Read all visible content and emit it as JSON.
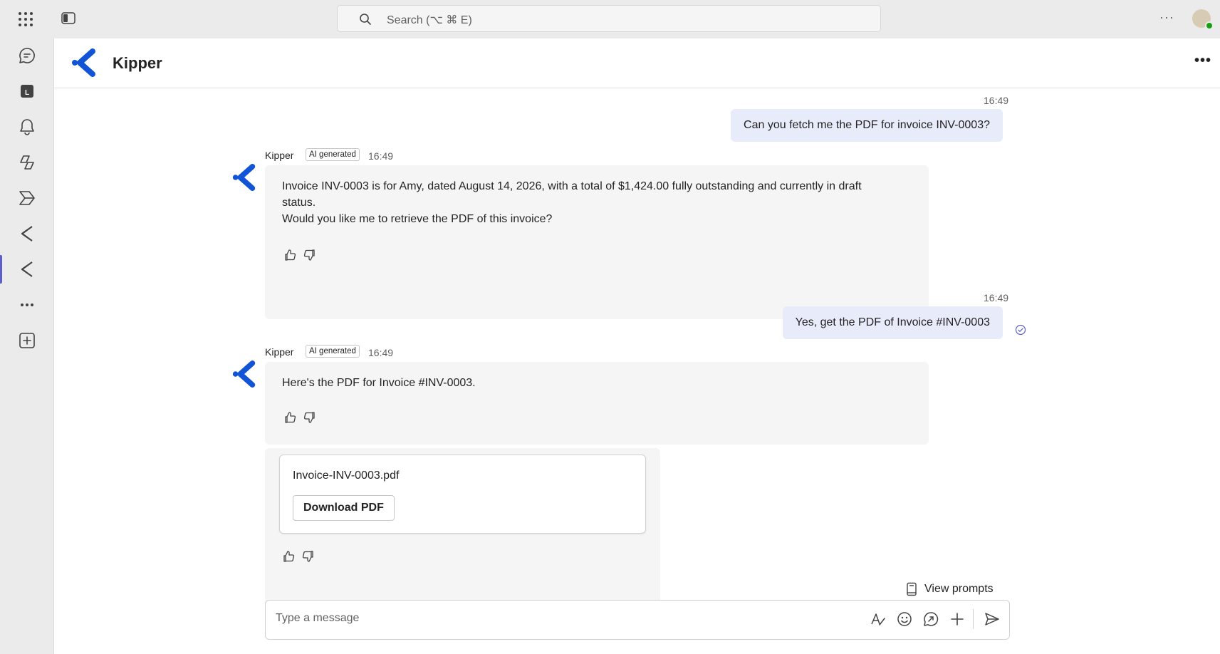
{
  "search": {
    "placeholder": "Search (⌥ ⌘ E)"
  },
  "topbar": {
    "icons": [
      "apps-icon",
      "panel-icon",
      "more-icon",
      "avatar"
    ]
  },
  "rail": {
    "items": [
      {
        "icon": "chat-icon"
      },
      {
        "icon": "calendar-icon"
      },
      {
        "icon": "bell-icon"
      },
      {
        "icon": "copilot-icon"
      },
      {
        "icon": "power-automate-icon"
      },
      {
        "icon": "kipper-app-icon"
      },
      {
        "icon": "kipper-app-icon",
        "active": true
      },
      {
        "icon": "more-apps-icon"
      },
      {
        "icon": "add-app-icon"
      }
    ]
  },
  "header": {
    "title": "Kipper"
  },
  "messages": [
    {
      "time": "16:49",
      "text": "Can you fetch me the PDF for invoice INV-0003?"
    },
    {
      "sender": "Kipper",
      "badge": "AI generated",
      "time": "16:49",
      "lines": [
        "Invoice INV-0003 is for Amy, dated August 14, 2026, with a total of $1,424.00 fully outstanding and currently in draft",
        "status.",
        "Would you like me to retrieve the PDF of this invoice?"
      ]
    },
    {
      "time": "16:49",
      "text": "Yes, get the PDF of Invoice #INV-0003"
    },
    {
      "sender": "Kipper",
      "badge": "AI generated",
      "time": "16:49",
      "text": "Here's the PDF for Invoice #INV-0003.",
      "attachment": {
        "filename": "Invoice-INV-0003.pdf",
        "button": "Download PDF"
      }
    }
  ],
  "view_prompts": "View prompts",
  "compose": {
    "placeholder": "Type a message"
  },
  "colors": {
    "accent": "#5b5fc7",
    "brand_blue": "#1254d6",
    "user_bubble": "#e8ebfa",
    "bot_bubble": "#f5f5f5",
    "presence": "#13a10e"
  }
}
